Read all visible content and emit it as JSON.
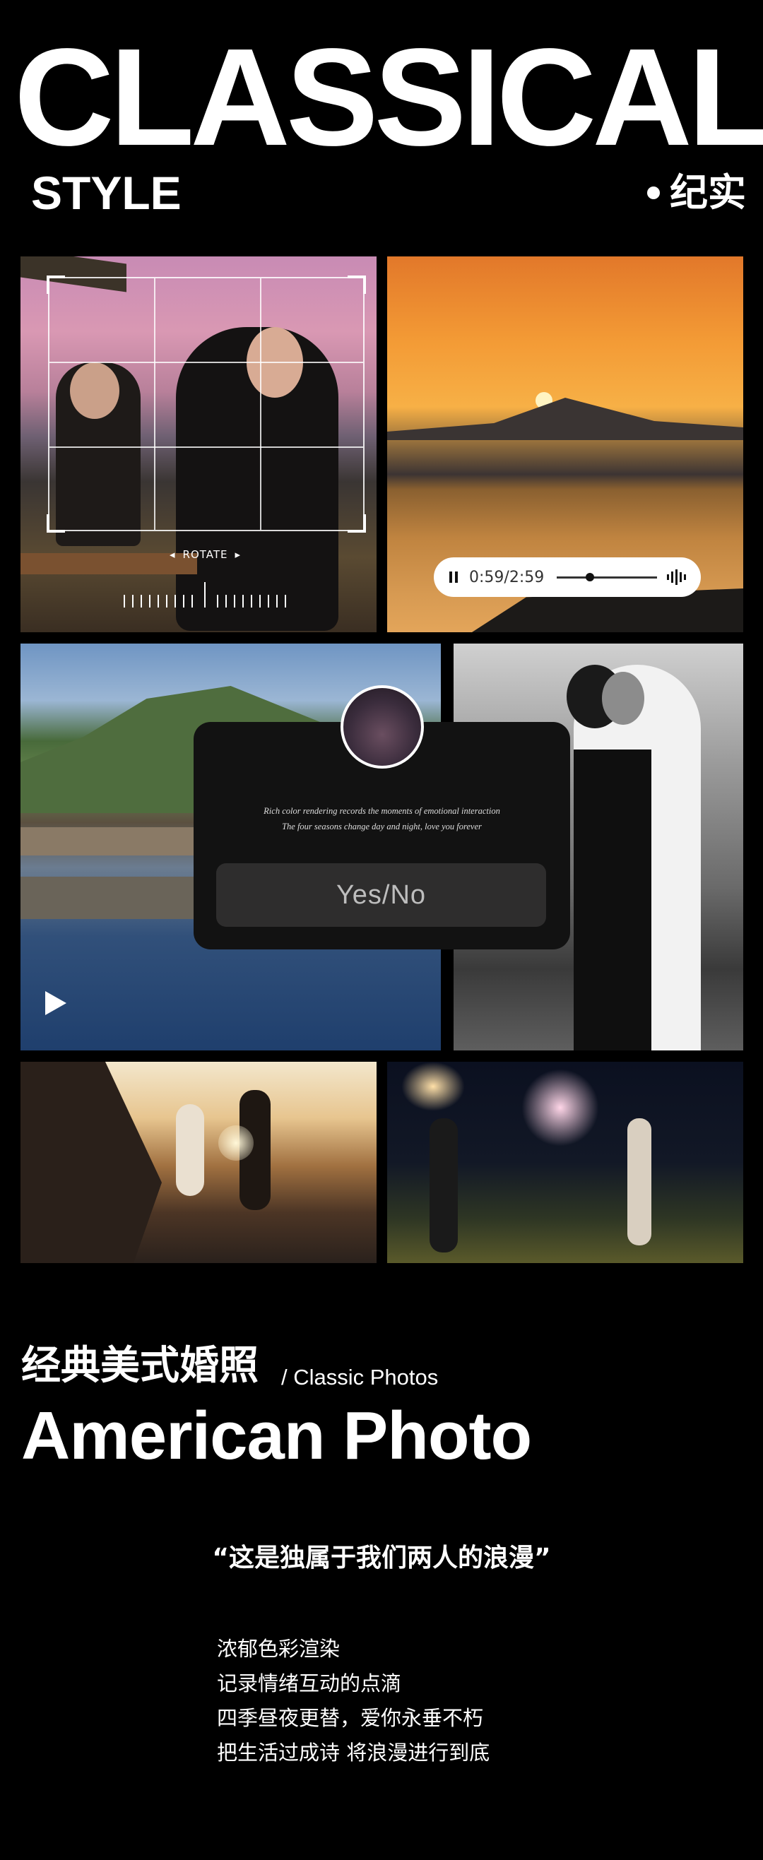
{
  "header": {
    "title": "CLASSICAL",
    "style_label": "STYLE",
    "tag": "纪实"
  },
  "gallery": {
    "rotate_label": "ROTATE",
    "audio": {
      "time": "0:59/2:59",
      "progress": 0.33
    },
    "dialog": {
      "line1": "Rich color rendering records the moments of emotional interaction",
      "line2": "The four seasons change day and night, love you forever",
      "button": "Yes/No"
    }
  },
  "section": {
    "cn_title": "经典美式婚照",
    "cn_sub": "/ Classic Photos",
    "en_title": "American Photo",
    "quote": "“这是独属于我们两人的浪漫”",
    "lines": [
      "浓郁色彩渲染",
      "记录情绪互动的点滴",
      "四季昼夜更替，爱你永垂不朽",
      "把生活过成诗 将浪漫进行到底"
    ]
  },
  "colors": {
    "background": "#000000",
    "text": "#ffffff",
    "dialog": "#121212",
    "button": "#2e2d2d"
  },
  "icons": [
    "pause-icon",
    "waveform-icon",
    "play-icon",
    "rotate-left-icon",
    "rotate-right-icon"
  ]
}
